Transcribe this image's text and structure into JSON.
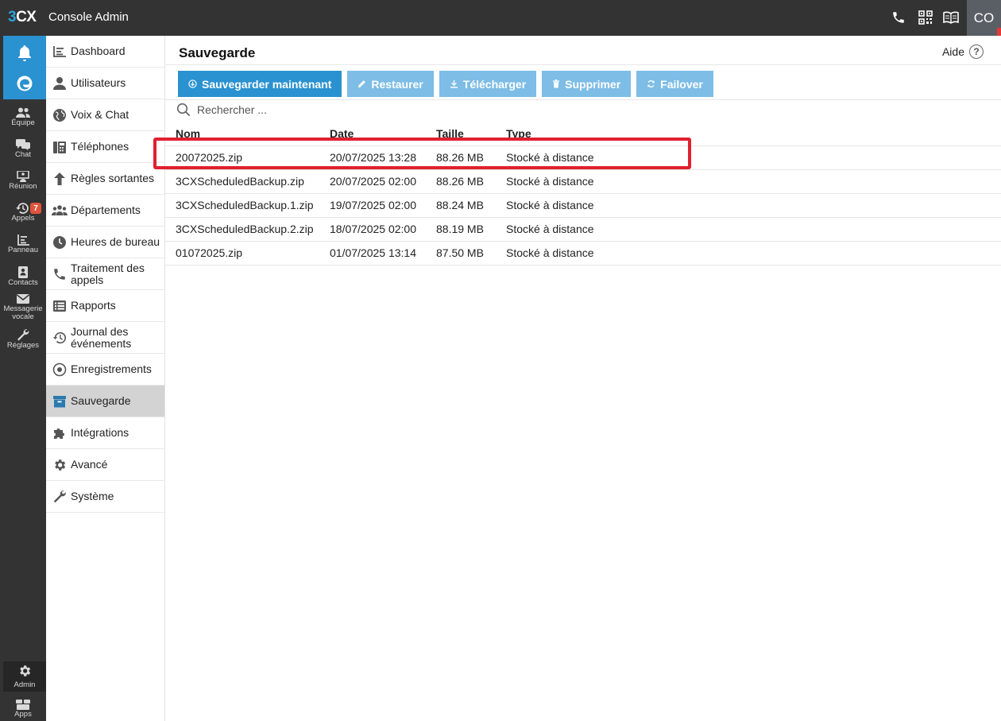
{
  "topbar": {
    "logo_3": "3",
    "logo_cx": "CX",
    "title": "Console Admin",
    "avatar_initials": "CO",
    "icons": [
      "phone-icon",
      "qr-code-icon",
      "book-icon"
    ]
  },
  "rail": {
    "items": [
      {
        "label": "Équipe",
        "icon": "team-icon"
      },
      {
        "label": "Chat",
        "icon": "chat-icon"
      },
      {
        "label": "Réunion",
        "icon": "meeting-icon"
      },
      {
        "label": "Appels",
        "icon": "history-icon",
        "badge": "7"
      },
      {
        "label": "Panneau",
        "icon": "panel-icon"
      },
      {
        "label": "Contacts",
        "icon": "contacts-icon"
      },
      {
        "label": "Messagerie vocale",
        "icon": "voicemail-icon"
      },
      {
        "label": "Réglages",
        "icon": "wrench-icon"
      }
    ],
    "admin_label": "Admin",
    "apps_label": "Apps"
  },
  "menu": {
    "items": [
      {
        "label": "Dashboard",
        "icon": "dashboard-icon"
      },
      {
        "label": "Utilisateurs",
        "icon": "user-icon"
      },
      {
        "label": "Voix & Chat",
        "icon": "globe-icon"
      },
      {
        "label": "Téléphones",
        "icon": "desk-phone-icon"
      },
      {
        "label": "Règles sortantes",
        "icon": "arrow-up-icon"
      },
      {
        "label": "Départements",
        "icon": "departments-icon"
      },
      {
        "label": "Heures de bureau",
        "icon": "clock-icon"
      },
      {
        "label": "Traitement des appels",
        "icon": "phone-handset-icon"
      },
      {
        "label": "Rapports",
        "icon": "list-icon"
      },
      {
        "label": "Journal des événements",
        "icon": "history-icon"
      },
      {
        "label": "Enregistrements",
        "icon": "record-icon"
      },
      {
        "label": "Sauvegarde",
        "icon": "archive-icon",
        "active": true
      },
      {
        "label": "Intégrations",
        "icon": "puzzle-icon"
      },
      {
        "label": "Avancé",
        "icon": "gear-icon"
      },
      {
        "label": "Système",
        "icon": "wrench-icon"
      }
    ]
  },
  "main": {
    "title": "Sauvegarde",
    "help_label": "Aide",
    "toolbar": {
      "backup_now": "Sauvegarder maintenant",
      "restore": "Restaurer",
      "download": "Télécharger",
      "delete": "Supprimer",
      "failover": "Failover"
    },
    "search_placeholder": "Rechercher ...",
    "columns": {
      "name": "Nom",
      "date": "Date",
      "size": "Taille",
      "type": "Type"
    },
    "rows": [
      {
        "name": "20072025.zip",
        "date": "20/07/2025 13:28",
        "size": "88.26 MB",
        "type": "Stocké à distance"
      },
      {
        "name": "3CXScheduledBackup.zip",
        "date": "20/07/2025 02:00",
        "size": "88.26 MB",
        "type": "Stocké à distance"
      },
      {
        "name": "3CXScheduledBackup.1.zip",
        "date": "19/07/2025 02:00",
        "size": "88.24 MB",
        "type": "Stocké à distance"
      },
      {
        "name": "3CXScheduledBackup.2.zip",
        "date": "18/07/2025 02:00",
        "size": "88.19 MB",
        "type": "Stocké à distance"
      },
      {
        "name": "01072025.zip",
        "date": "01/07/2025 13:14",
        "size": "87.50 MB",
        "type": "Stocké à distance"
      }
    ]
  },
  "colors": {
    "topbar": "#333333",
    "accent": "#2a92d0",
    "accent_light": "#7dbde6",
    "highlight": "#e02030",
    "badge": "#e0533c"
  }
}
